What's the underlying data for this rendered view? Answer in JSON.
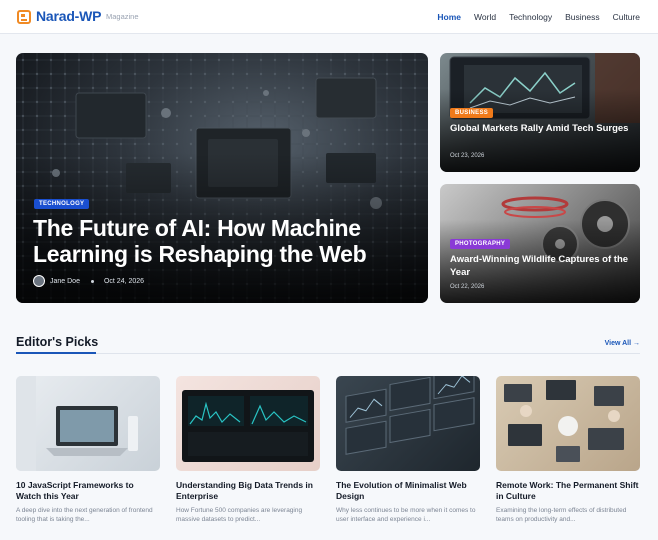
{
  "header": {
    "brand": "Narad-WP",
    "tagline": "Magazine",
    "nav": [
      {
        "label": "Home",
        "active": true
      },
      {
        "label": "World",
        "active": false
      },
      {
        "label": "Technology",
        "active": false
      },
      {
        "label": "Business",
        "active": false
      },
      {
        "label": "Culture",
        "active": false
      }
    ]
  },
  "hero": {
    "category": "TECHNOLOGY",
    "title": "The Future of AI: How Machine Learning is Reshaping the Web",
    "author": "Jane Doe",
    "date": "Oct 24, 2026"
  },
  "side_stories": [
    {
      "category": "BUSINESS",
      "title": "Global Markets Rally Amid Tech Surges",
      "date": "Oct 23, 2026"
    },
    {
      "category": "PHOTOGRAPHY",
      "title": "Award-Winning Wildlife Captures of the Year",
      "date": "Oct 22, 2026"
    }
  ],
  "editors_picks": {
    "title": "Editor's Picks",
    "view_all": "View All →",
    "cards": [
      {
        "title": "10 JavaScript Frameworks to Watch this Year",
        "desc": "A deep dive into the next generation of frontend tooling that is taking the..."
      },
      {
        "title": "Understanding Big Data Trends in Enterprise",
        "desc": "How Fortune 500 companies are leveraging massive datasets to predict..."
      },
      {
        "title": "The Evolution of Minimalist Web Design",
        "desc": "Why less continues to be more when it comes to user interface and experience i..."
      },
      {
        "title": "Remote Work: The Permanent Shift in Culture",
        "desc": "Examining the long-term effects of distributed teams on productivity and..."
      }
    ]
  },
  "colors": {
    "brand": "#1a56b8",
    "technology_badge": "#1a4fd0",
    "business_badge": "#f07a1a",
    "photography_badge": "#8a3ad6",
    "logo_accent": "#f08a24"
  }
}
